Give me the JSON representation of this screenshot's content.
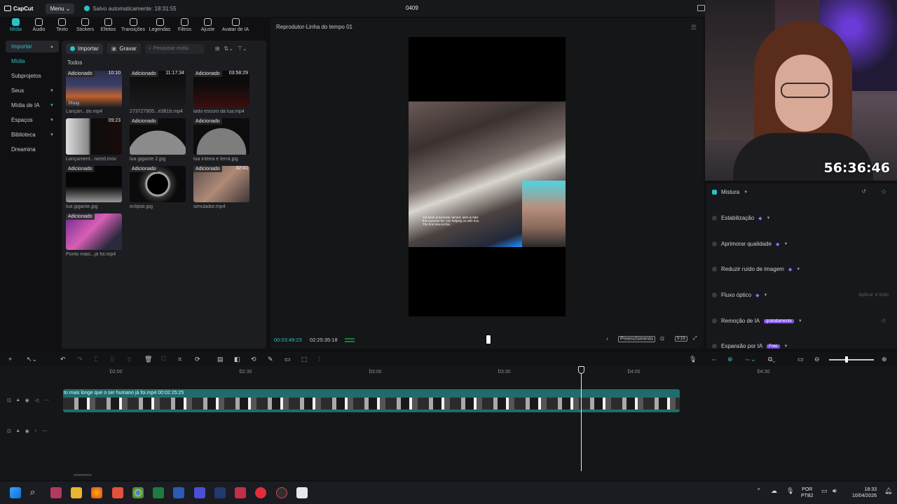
{
  "app": {
    "logo_text": "CapCut",
    "menu_label": "Menu",
    "autosave_text": "Salvo automaticamente: 18:31:55",
    "project_name": "0409"
  },
  "tabs": [
    {
      "label": "Mídia",
      "active": true
    },
    {
      "label": "Áudio"
    },
    {
      "label": "Texto"
    },
    {
      "label": "Stickers"
    },
    {
      "label": "Efeitos"
    },
    {
      "label": "Transições"
    },
    {
      "label": "Legendas"
    },
    {
      "label": "Filtros"
    },
    {
      "label": "Ajuste"
    },
    {
      "label": "Avatar de IA"
    }
  ],
  "leftnav": [
    {
      "label": "Importar",
      "selected": true
    },
    {
      "label": "Mídia",
      "sub": true
    },
    {
      "label": "Subprojetos"
    },
    {
      "label": "Seus"
    },
    {
      "label": "Mídia de IA"
    },
    {
      "label": "Espaços"
    },
    {
      "label": "Biblioteca"
    },
    {
      "label": "Dreamina"
    }
  ],
  "media": {
    "import_label": "Importar",
    "record_label": "Gravar",
    "search_placeholder": "Pesquisar mídia",
    "section_label": "Todos",
    "items": [
      {
        "badge": "Adicionado",
        "duration": "10:10",
        "caption": "Lançan...do.mp4",
        "proxy": "Proxy",
        "style": "t-rocket"
      },
      {
        "badge": "Adicionado",
        "duration": "11:17:34",
        "caption": "273727905...e381b.mp4",
        "style": "t-dark"
      },
      {
        "badge": "Adicionado",
        "duration": "03:58:29",
        "caption": "lado escuro da lua.mp4",
        "style": "t-red"
      },
      {
        "badge": "",
        "duration": "09:23",
        "caption": "Lançament...rared.mov",
        "style": "t-launch"
      },
      {
        "badge": "Adicionado",
        "duration": "",
        "caption": "lua gigante 2.jpg",
        "style": "t-moon"
      },
      {
        "badge": "Adicionado",
        "duration": "",
        "caption": "lua inteira e terra.jpg",
        "style": "t-moon2"
      },
      {
        "badge": "Adicionado",
        "duration": "",
        "caption": "lua gigante.jpg",
        "style": "t-earth"
      },
      {
        "badge": "Adicionado",
        "duration": "",
        "caption": "eclipse.jpg",
        "style": "t-eclipse"
      },
      {
        "badge": "Adicionado",
        "duration": "32:41",
        "caption": "simulador.mp4",
        "style": "t-sim"
      },
      {
        "badge": "Adicionado",
        "duration": "",
        "caption": "Ponto mais...já foi.mp4",
        "style": "t-ponto"
      }
    ]
  },
  "player": {
    "title": "Reprodutor-Linha do tempo 01",
    "current_time": "00:03:49:23",
    "total_time": "02:25:35:18",
    "fill_label": "Preenchimento",
    "ratio_label": "9:16",
    "subtitle_text": "not been previously named, and us take this moment for. Our helping us with this. The first time at this"
  },
  "webcam": {
    "timer": "56:36:46"
  },
  "properties": [
    {
      "label": "Mistura",
      "enabled": true,
      "reset": "↺"
    },
    {
      "label": "Estabilização",
      "gem": true
    },
    {
      "label": "Aprimorar qualidade",
      "gem": true
    },
    {
      "label": "Reduzir ruído de imagem",
      "gem": true
    },
    {
      "label": "Fluxo óptico",
      "gem": true,
      "apply": "Aplicar a todo"
    },
    {
      "label": "Remoção de IA",
      "pill": "gratuitamente"
    },
    {
      "label": "Expansão por IA",
      "pill": "Free"
    }
  ],
  "timeline": {
    "ruler": [
      "02:00",
      "02:30",
      "03:00",
      "03:30",
      "04:00",
      "04:30"
    ],
    "clip_label": "to mais longe que o ser humano já foi.mp4   00:02:25:25"
  },
  "taskbar": {
    "lang_top": "POR",
    "lang_bottom": "PTB2",
    "time": "18:33",
    "date": "10/04/2026"
  }
}
